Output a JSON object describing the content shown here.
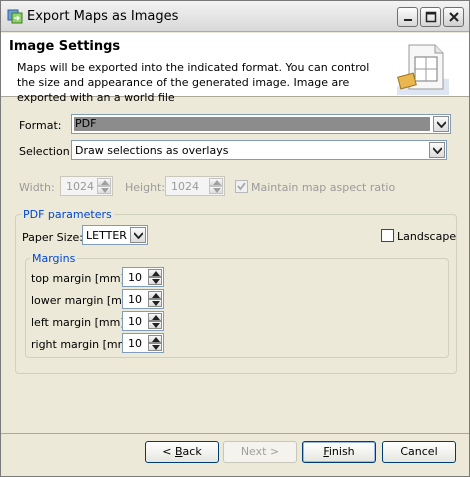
{
  "window": {
    "title": "Export Maps as Images"
  },
  "header": {
    "title": "Image Settings",
    "description": "Maps will be exported into the indicated format. You can control the size and appearance of the generated image. Image are exported with an a world file"
  },
  "form": {
    "format_label": "Format:",
    "format_value": "PDF",
    "selection_label": "Selection:",
    "selection_value": "Draw selections as overlays",
    "width_label": "Width:",
    "width_value": "1024",
    "height_label": "Height:",
    "height_value": "1024",
    "aspect_label": "Maintain map aspect ratio",
    "aspect_checked": true
  },
  "pdf": {
    "legend": "PDF parameters",
    "paper_size_label": "Paper Size:",
    "paper_size_value": "LETTER",
    "landscape_label": "Landscape",
    "landscape_checked": false,
    "margins_legend": "Margins",
    "margins": [
      {
        "label": "top margin [mm]",
        "value": "10"
      },
      {
        "label": "lower margin [mm]",
        "value": "10"
      },
      {
        "label": "left margin [mm]",
        "value": "10"
      },
      {
        "label": "right margin [mm]",
        "value": "10"
      }
    ]
  },
  "footer": {
    "back_pre": "< ",
    "back_mnemonic": "B",
    "back_post": "ack",
    "next_label": "Next >",
    "finish_mnemonic": "F",
    "finish_post": "inish",
    "cancel_label": "Cancel"
  },
  "colors": {
    "window_bg": "#ece9d8",
    "group_legend": "#0046d5",
    "field_border": "#7f9db9"
  },
  "icons": {
    "title_icon": "export-maps-icon",
    "header_graphic": "wizard-image-icon"
  }
}
